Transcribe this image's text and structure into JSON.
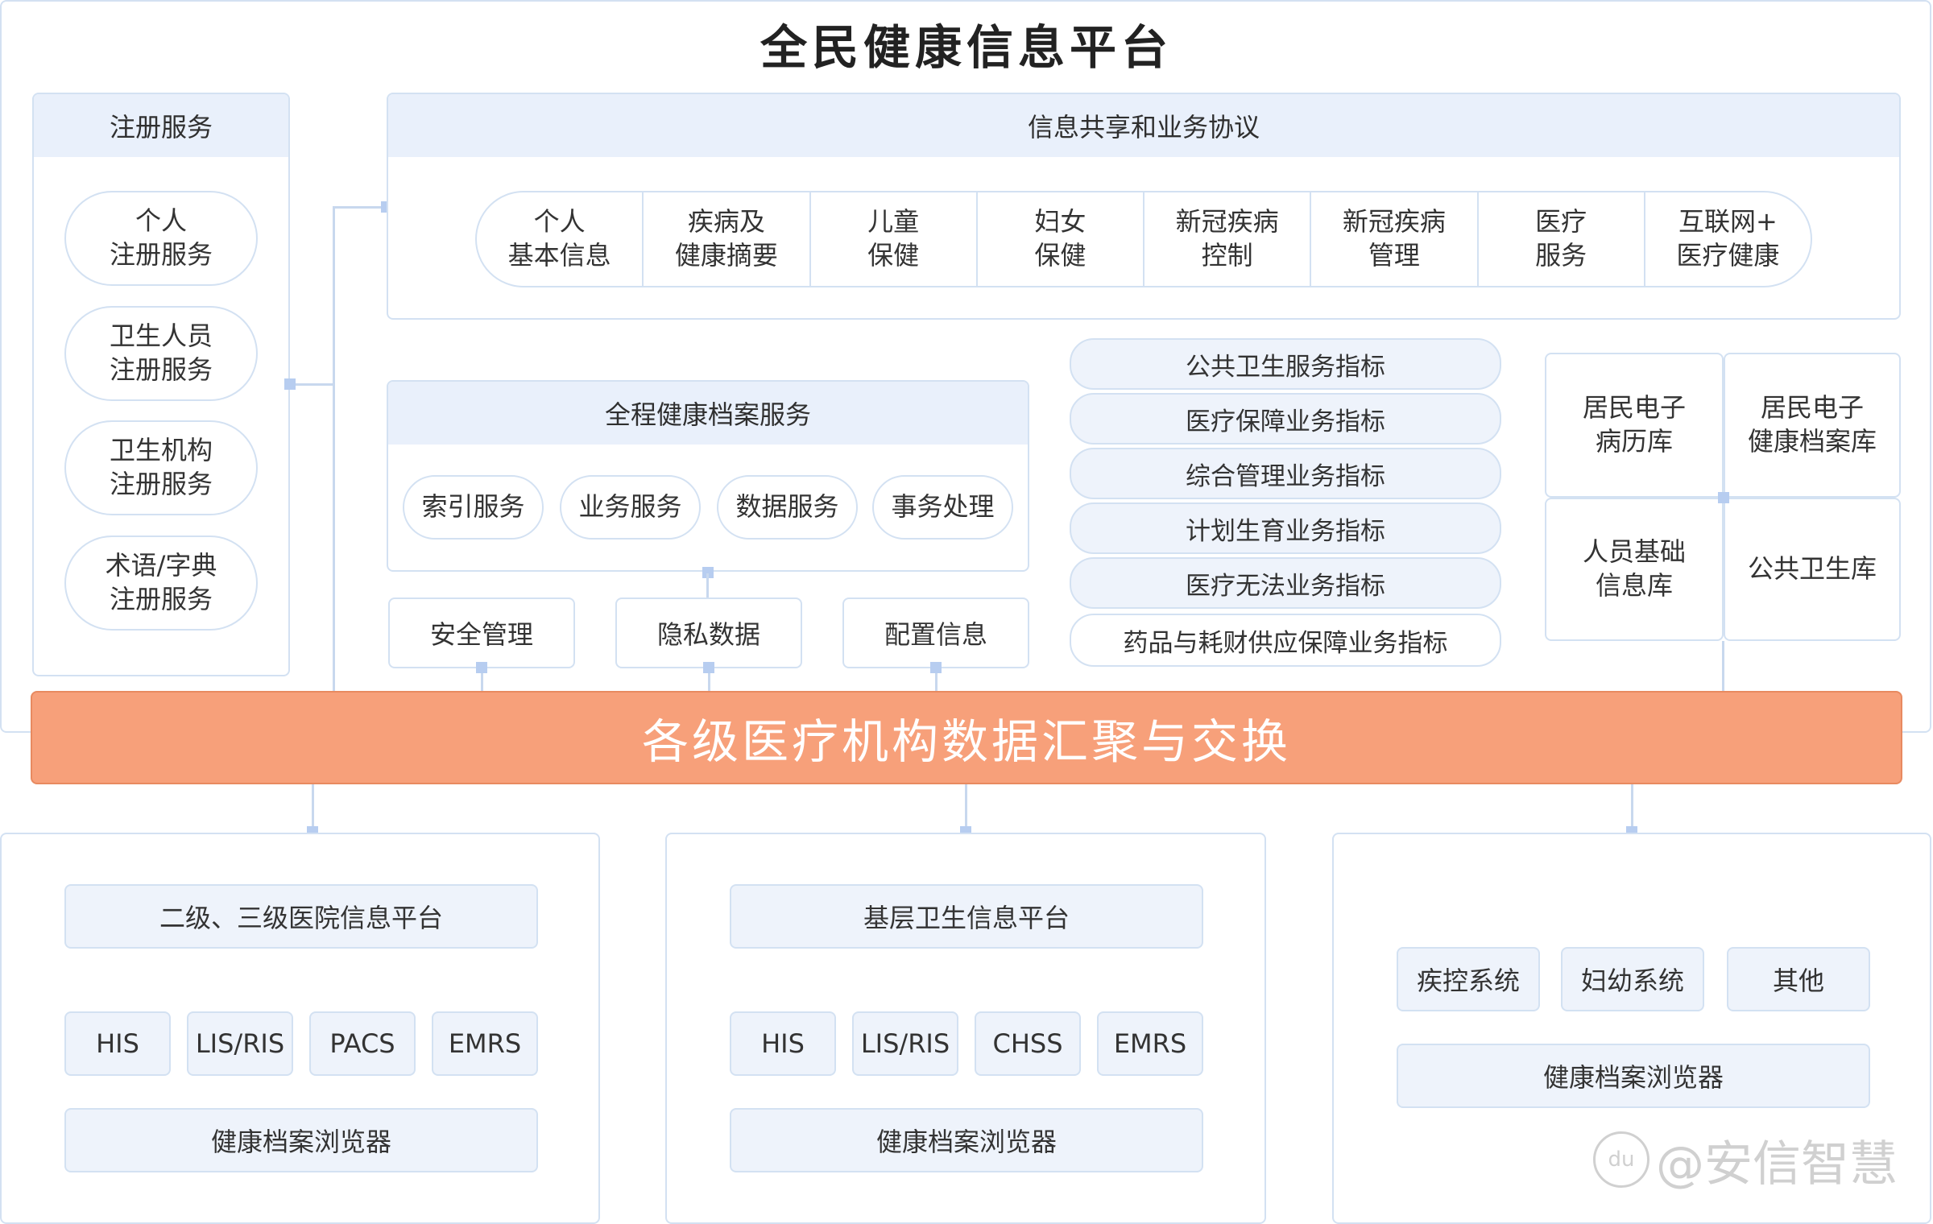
{
  "title": "全民健康信息平台",
  "registration": {
    "header": "注册服务",
    "items": [
      "个人\n注册服务",
      "卫生人员\n注册服务",
      "卫生机构\n注册服务",
      "术语/字典\n注册服务"
    ]
  },
  "sharing": {
    "header": "信息共享和业务协议",
    "items": [
      "个人\n基本信息",
      "疾病及\n健康摘要",
      "儿童\n保健",
      "妇女\n保健",
      "新冠疾病\n控制",
      "新冠疾病\n管理",
      "医疗\n服务",
      "互联网+\n医疗健康"
    ]
  },
  "records": {
    "header": "全程健康档案服务",
    "items": [
      "索引服务",
      "业务服务",
      "数据服务",
      "事务处理"
    ]
  },
  "support": [
    "安全管理",
    "隐私数据",
    "配置信息"
  ],
  "indicators": [
    "公共卫生服务指标",
    "医疗保障业务指标",
    "综合管理业务指标",
    "计划生育业务指标",
    "医疗无法业务指标",
    "药品与耗财供应保障业务指标"
  ],
  "databases": [
    "居民电子\n病历库",
    "居民电子\n健康档案库",
    "人员基础\n信息库",
    "公共卫生库"
  ],
  "exchange": "各级医疗机构数据汇聚与交换",
  "hospital": {
    "header": "二级、三级医院信息平台",
    "systems": [
      "HIS",
      "LIS/RIS",
      "PACS",
      "EMRS"
    ],
    "browser": "健康档案浏览器"
  },
  "primary": {
    "header": "基层卫生信息平台",
    "systems": [
      "HIS",
      "LIS/RIS",
      "CHSS",
      "EMRS"
    ],
    "browser": "健康档案浏览器"
  },
  "public_health": {
    "systems": [
      "疾控系统",
      "妇幼系统",
      "其他"
    ],
    "browser": "健康档案浏览器"
  },
  "watermark": "@安信智慧",
  "watermark_badge": "du"
}
